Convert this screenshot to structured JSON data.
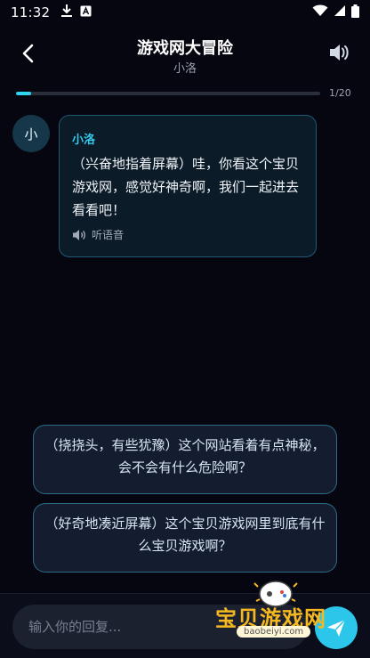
{
  "status_bar": {
    "time": "11:32",
    "icons": [
      "download-icon",
      "app-a-icon",
      "wifi-icon",
      "signal-icon",
      "battery-icon"
    ]
  },
  "header": {
    "title": "游戏网大冒险",
    "subtitle": "小洛"
  },
  "progress": {
    "text": "1/20",
    "fraction": 0.05
  },
  "message": {
    "avatar_char": "小",
    "name": "小洛",
    "text": "（兴奋地指着屏幕）哇，你看这个宝贝游戏网，感觉好神奇啊，我们一起进去看看吧！",
    "listen_label": "听语音"
  },
  "choices": [
    "（挠挠头，有些犹豫）这个网站看着有点神秘，会不会有什么危险啊？",
    "（好奇地凑近屏幕）这个宝贝游戏网里到底有什么宝贝游戏啊？"
  ],
  "composer": {
    "placeholder": "输入你的回复..."
  },
  "watermark": {
    "text": "宝贝游戏网",
    "url": "baobeiyi.com"
  },
  "colors": {
    "accent": "#2cc6ea",
    "background": "#05060f",
    "watermark": "#f5b820"
  }
}
